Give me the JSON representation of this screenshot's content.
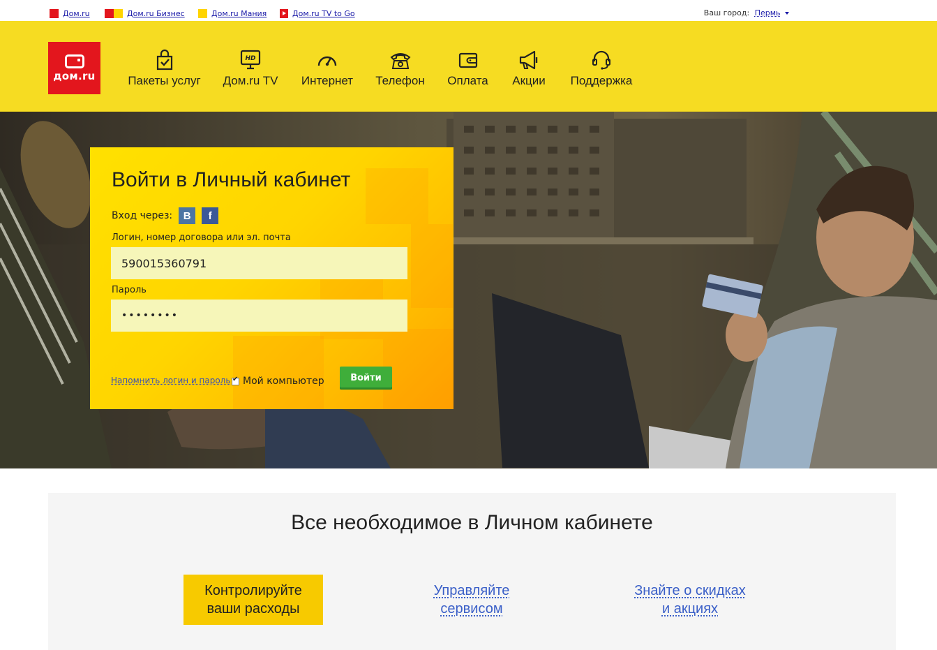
{
  "topbar": {
    "links": [
      {
        "label": "Дом.ru"
      },
      {
        "label": "Дом.ru Бизнес"
      },
      {
        "label": "Дом.ru Мания"
      },
      {
        "label": "Дом.ru TV to Go"
      }
    ],
    "city_label": "Ваш город:",
    "city_value": "Пермь"
  },
  "header": {
    "logo_text": "дом.ru",
    "nav": [
      {
        "label": "Пакеты услуг",
        "icon": "shopping-bag-icon"
      },
      {
        "label": "Дом.ru TV",
        "icon": "hd-tv-icon"
      },
      {
        "label": "Интернет",
        "icon": "speedometer-icon"
      },
      {
        "label": "Телефон",
        "icon": "phone-icon"
      },
      {
        "label": "Оплата",
        "icon": "wallet-icon"
      },
      {
        "label": "Акции",
        "icon": "megaphone-icon"
      },
      {
        "label": "Поддержка",
        "icon": "headset-icon"
      }
    ]
  },
  "login": {
    "title": "Войти в Личный кабинет",
    "via_label": "Вход через:",
    "vk_label": "В",
    "fb_label": "f",
    "login_label": "Логин, номер договора или эл. почта",
    "login_value": "590015360791",
    "password_label": "Пароль",
    "password_value": "••••••••",
    "remind_link": "Напомнить логин и пароль",
    "remember_label": "Мой компьютер",
    "remember_checked": true,
    "submit_label": "Войти"
  },
  "features": {
    "title": "Все необходимое в Личном кабинете",
    "items": [
      {
        "line1": "Контролируйте",
        "line2": "ваши расходы"
      },
      {
        "line1": "Управляйте",
        "line2": "сервисом"
      },
      {
        "line1": "Знайте о скидках",
        "line2": "и акциях"
      }
    ]
  },
  "colors": {
    "brand_red": "#e3161d",
    "header_yellow": "#f6dc22",
    "button_green": "#3fae3a",
    "link_blue": "#3a5fc8"
  }
}
